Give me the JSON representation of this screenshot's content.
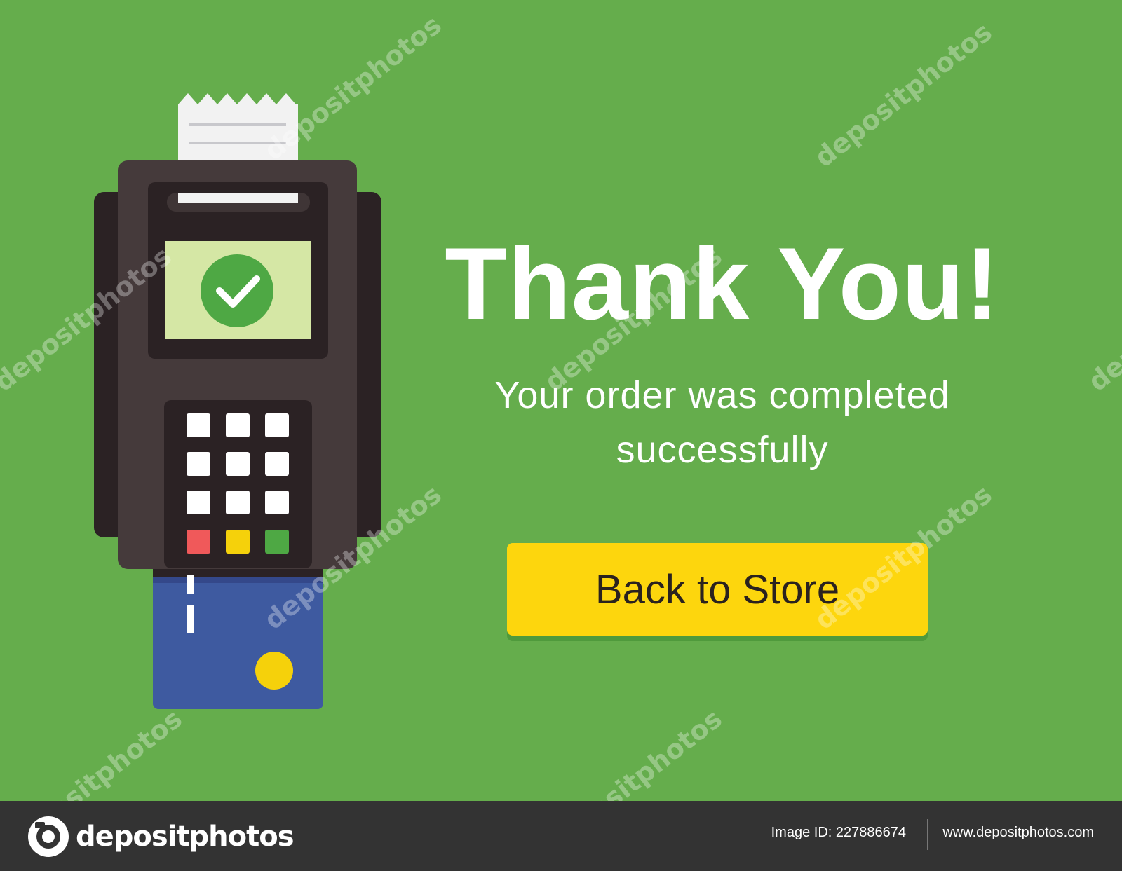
{
  "page": {
    "title": "Thank You!",
    "subtitle_line1": "Your order was completed",
    "subtitle_line2": "successfully",
    "button_label": "Back to Store"
  },
  "terminal": {
    "icons": [
      "payment-terminal-icon",
      "receipt-icon",
      "check-icon",
      "keypad-icon",
      "credit-card-icon"
    ],
    "key_colors": [
      "#f0595a",
      "#f5d10b",
      "#4ea844"
    ]
  },
  "watermark": {
    "text": "depositphotos"
  },
  "footer": {
    "brand": "depositphotos",
    "image_id_label": "Image ID:",
    "image_id": "227886674",
    "url": "www.depositphotos.com"
  },
  "colors": {
    "background": "#65ad4c",
    "button": "#fdd60d",
    "terminal_body": "#453a3b",
    "screen": "#d5e7a5",
    "card": "#3e5aa0",
    "footer": "#333333"
  }
}
